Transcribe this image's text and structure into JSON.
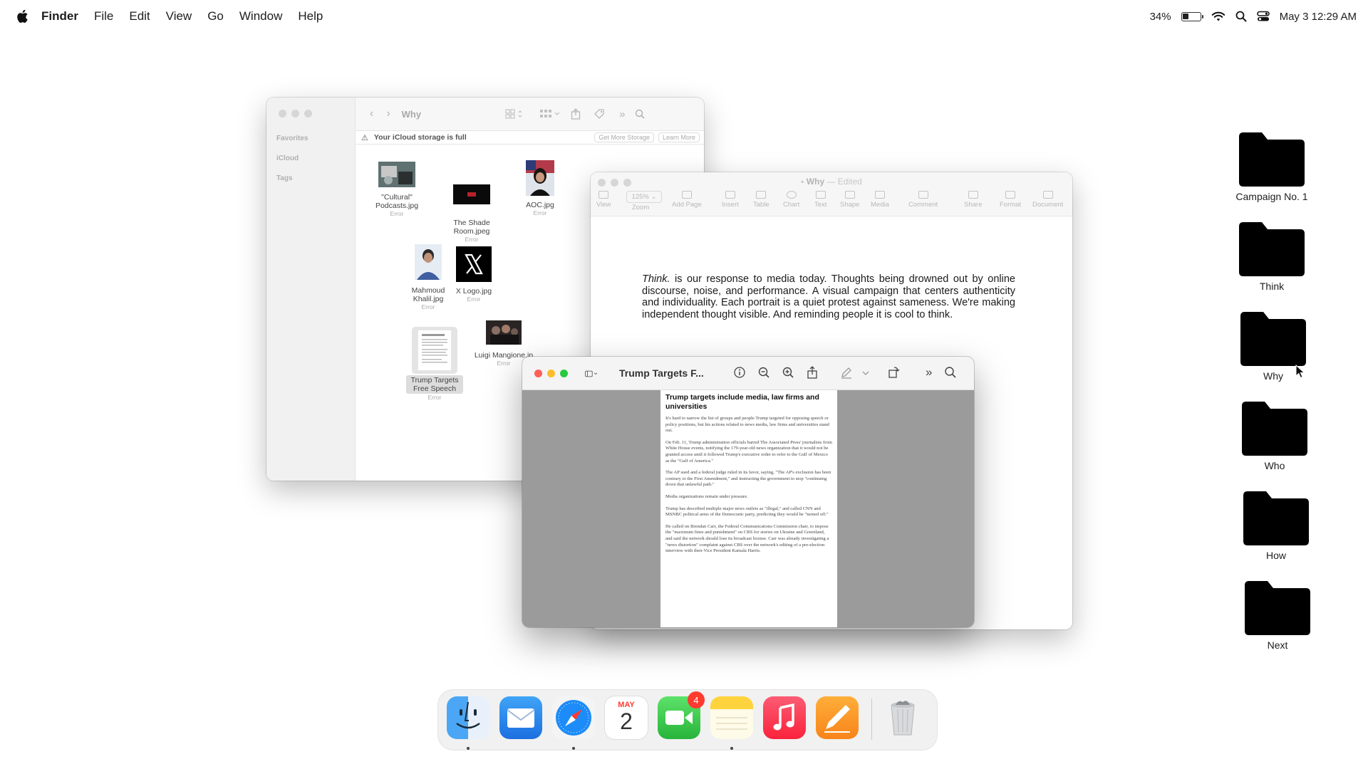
{
  "menubar": {
    "app_name": "Finder",
    "menus": [
      "File",
      "Edit",
      "View",
      "Go",
      "Window",
      "Help"
    ],
    "battery_percent": "34%",
    "battery_level": 0.34,
    "datetime": "May 3  12:29 AM"
  },
  "desktop_folders": [
    {
      "label": "Campaign No. 1"
    },
    {
      "label": "Think"
    },
    {
      "label": "Why"
    },
    {
      "label": "Who"
    },
    {
      "label": "How"
    },
    {
      "label": "Next"
    }
  ],
  "finder": {
    "title": "Why",
    "sidebar": [
      "Favorites",
      "iCloud",
      "Tags"
    ],
    "notice": "Your iCloud storage is full",
    "notice_buttons": [
      "Get More Storage",
      "Learn More"
    ],
    "files": [
      {
        "name": "\"Cultural\" Podcasts.jpg",
        "status": "Error"
      },
      {
        "name": "The Shade Room.jpeg",
        "status": "Error"
      },
      {
        "name": "AOC.jpg",
        "status": "Error"
      },
      {
        "name": "Mahmoud Khalil.jpg",
        "status": "Error"
      },
      {
        "name": "X Logo.jpg",
        "status": "Error"
      },
      {
        "name": "Trump Targets Free Speech",
        "status": "Error"
      },
      {
        "name": "Luigi Mangione.jp",
        "status": "Error"
      }
    ]
  },
  "pages": {
    "title": "Why",
    "edited": "— Edited",
    "zoom": "125%",
    "tools": [
      "View",
      "Zoom",
      "Add Page",
      "Insert",
      "Table",
      "Chart",
      "Text",
      "Shape",
      "Media",
      "Comment",
      "Share",
      "Format",
      "Document"
    ],
    "body_lead": "Think.",
    "body_text": " is our response to media today. Thoughts being drowned out by online discourse, noise, and performance. A visual campaign that centers authenticity and individuality. Each portrait is a quiet protest against sameness. We're making independent thought visible. And reminding people it is cool to think."
  },
  "preview": {
    "title": "Trump Targets F...",
    "heading": "Trump targets include media, law firms and universities",
    "paragraphs": [
      "It's hard to narrow the list of groups and people Trump targeted for opposing speech or policy positions, but his actions related to news media, law firms and universities stand out.",
      "On Feb. 11, Trump administration officials barred The Associated Press' journalists from White House events, notifying the 179-year-old news organization that it would not be granted access until it followed Trump's executive order to refer to the Gulf of Mexico as the \"Gulf of America.\"",
      "The AP sued and a federal judge ruled in its favor, saying, \"The AP's exclusion has been contrary to the First Amendment,\" and instructing the government to stop \"continuing down that unlawful path.\"",
      "Media organizations remain under pressure.",
      "Trump has described multiple major news outlets as \"illegal,\" and called CNN and MSNBC political arms of the Democratic party, predicting they would be \"turned off.\"",
      "He called on Brendan Carr, the Federal Communications Commission chair, to impose the \"maximum fines and punishment\" on CBS for stories on Ukraine and Greenland, and said the network should lose its broadcast license. Carr was already investigating a \"news distortion\" complaint against CBS over the network's editing of a pre-election interview with then-Vice President Kamala Harris."
    ]
  },
  "dock": {
    "apps": [
      {
        "name": "Finder"
      },
      {
        "name": "Mail"
      },
      {
        "name": "Safari"
      },
      {
        "name": "Calendar",
        "month": "MAY",
        "day": "2"
      },
      {
        "name": "FaceTime",
        "badge": "4"
      },
      {
        "name": "Notes"
      },
      {
        "name": "Music"
      },
      {
        "name": "Pages"
      },
      {
        "name": "Trash"
      }
    ]
  },
  "colors": {
    "close": "#ff5f57",
    "minimize": "#febc2e",
    "zoom": "#28c840",
    "badge": "#ff3b30",
    "link": "#3a6fd8"
  }
}
